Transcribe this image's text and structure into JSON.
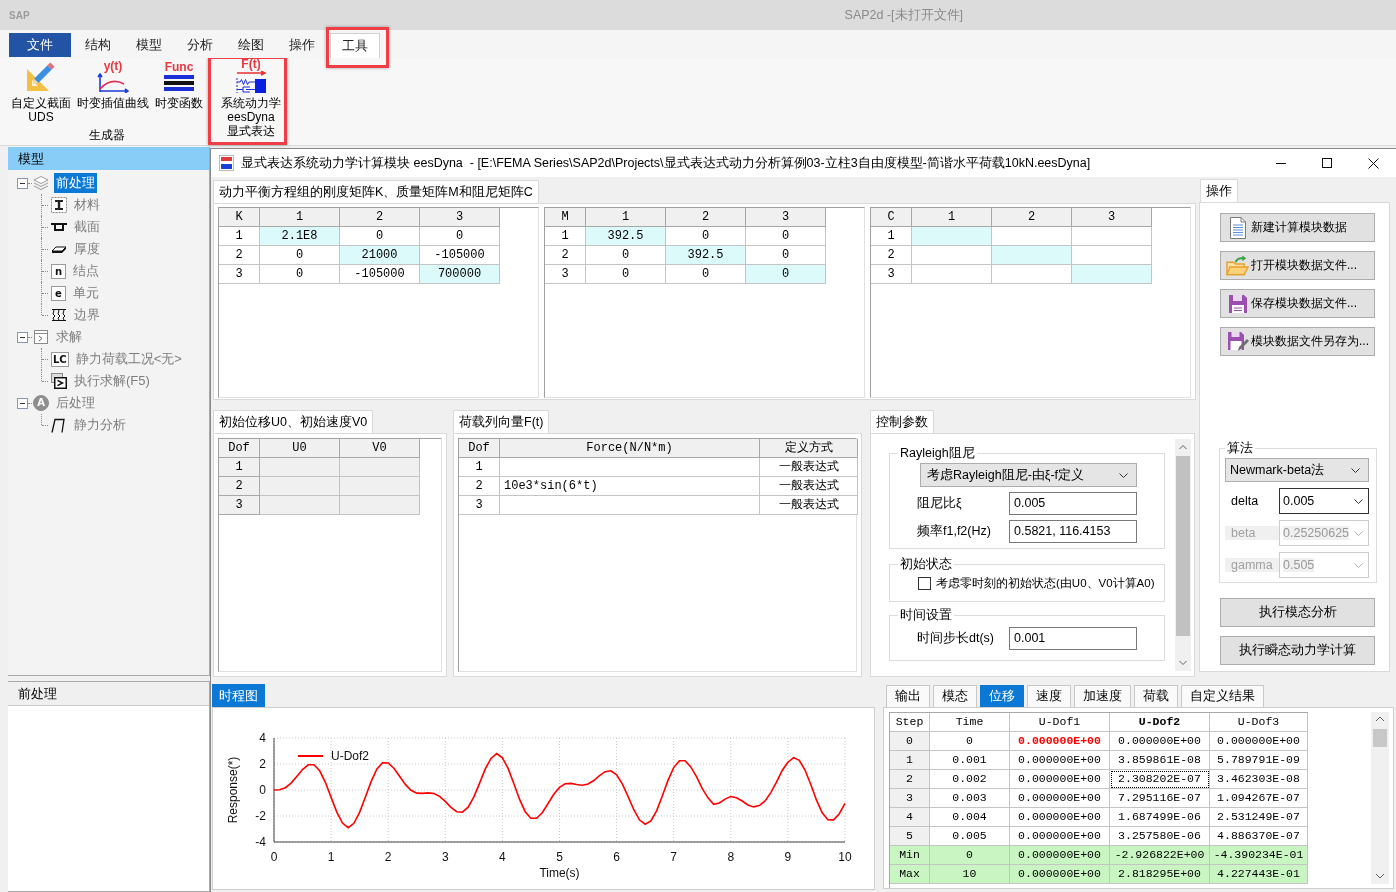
{
  "window": {
    "app_mark": "SAP",
    "title": "SAP2d -[未打开文件]"
  },
  "ribbon": {
    "tabs": [
      {
        "label": "文件",
        "kind": "menu",
        "selected": false,
        "highlighted": false
      },
      {
        "label": "结构",
        "kind": "tab",
        "selected": false,
        "highlighted": false
      },
      {
        "label": "模型",
        "kind": "tab",
        "selected": false,
        "highlighted": false
      },
      {
        "label": "分析",
        "kind": "tab",
        "selected": false,
        "highlighted": false
      },
      {
        "label": "绘图",
        "kind": "tab",
        "selected": false,
        "highlighted": false
      },
      {
        "label": "操作",
        "kind": "tab",
        "selected": false,
        "highlighted": false
      },
      {
        "label": "工具",
        "kind": "tab",
        "selected": true,
        "highlighted": true
      }
    ],
    "groups": [
      {
        "label": "生成器",
        "tools": [
          {
            "kind": "section",
            "label_lines": [
              "自定义截面",
              "UDS"
            ],
            "highlighted": false
          },
          {
            "kind": "curve",
            "icon_text": "y(t)",
            "label_lines": [
              "时变插值曲线"
            ],
            "highlighted": false
          },
          {
            "kind": "function",
            "icon_text": "Func",
            "label_lines": [
              "时变函数"
            ],
            "highlighted": false
          }
        ]
      },
      {
        "tools": [
          {
            "kind": "dynamics",
            "icon_text": "F(t)",
            "label_lines": [
              "系统动力学",
              "eesDyna",
              "显式表达"
            ],
            "highlighted": true
          }
        ]
      }
    ]
  },
  "model_panel": {
    "title": "模型",
    "tree": [
      {
        "label": "前处理",
        "kind": "layers",
        "expanded": true,
        "selected": true,
        "children": [
          {
            "label": "材料",
            "kind": "material",
            "selected": false
          },
          {
            "label": "截面",
            "kind": "section",
            "selected": false
          },
          {
            "label": "厚度",
            "kind": "thickness",
            "selected": false
          },
          {
            "label": "结点",
            "kind": "letter",
            "icon_text": "n",
            "selected": false
          },
          {
            "label": "单元",
            "kind": "letter",
            "icon_text": "e",
            "selected": false
          },
          {
            "label": "边界",
            "kind": "boundary",
            "selected": false
          }
        ]
      },
      {
        "label": "求解",
        "kind": "solve",
        "expanded": true,
        "selected": false,
        "children": [
          {
            "label": "静力荷载工况<无>",
            "kind": "letter",
            "icon_text": "LC",
            "selected": false
          },
          {
            "label": "执行求解(F5)",
            "kind": "run",
            "selected": false
          }
        ]
      },
      {
        "label": "后处理",
        "kind": "badge",
        "icon_text": "A",
        "expanded": true,
        "selected": false,
        "children": [
          {
            "label": "静力分析",
            "kind": "pulse",
            "selected": false
          }
        ]
      }
    ]
  },
  "pre_panel": {
    "title": "前处理"
  },
  "child_window": {
    "title": "显式表达系统动力学计算模块 eesDyna  - [E:\\FEMA Series\\SAP2d\\Projects\\显式表达式动力分析算例03-立柱3自由度模型-简谐水平荷载10kN.eesDyna]"
  },
  "matrix_tab": {
    "label": "动力平衡方程组的刚度矩阵K、质量矩阵M和阻尼矩阵C",
    "selected": true
  },
  "matrices": [
    {
      "name": "K",
      "diagonal_highlighted": true,
      "columns": [
        "1",
        "2",
        "3"
      ],
      "rows": [
        {
          "label": "1",
          "values": [
            "2.1E8",
            "0",
            "0"
          ]
        },
        {
          "label": "2",
          "values": [
            "0",
            "21000",
            "-105000"
          ]
        },
        {
          "label": "3",
          "values": [
            "0",
            "-105000",
            "700000"
          ]
        }
      ]
    },
    {
      "name": "M",
      "diagonal_highlighted": true,
      "columns": [
        "1",
        "2",
        "3"
      ],
      "rows": [
        {
          "label": "1",
          "values": [
            "392.5",
            "0",
            "0"
          ]
        },
        {
          "label": "2",
          "values": [
            "0",
            "392.5",
            "0"
          ]
        },
        {
          "label": "3",
          "values": [
            "0",
            "0",
            "0"
          ]
        }
      ]
    },
    {
      "name": "C",
      "diagonal_highlighted": true,
      "columns": [
        "1",
        "2",
        "3"
      ],
      "rows": [
        {
          "label": "1"
        },
        {
          "label": "2"
        },
        {
          "label": "3"
        }
      ]
    }
  ],
  "initial_panel": {
    "tab": {
      "label": "初始位移U0、初始速度V0",
      "selected": true
    },
    "disabled": true,
    "columns": [
      "Dof",
      "U0",
      "V0"
    ],
    "rows": [
      {
        "dof": "1"
      },
      {
        "dof": "2"
      },
      {
        "dof": "3"
      }
    ]
  },
  "load_panel": {
    "tab": {
      "label": "荷载列向量F(t)",
      "selected": true
    },
    "columns": [
      "Dof",
      "Force(N/N*m)",
      "定义方式"
    ],
    "rows": [
      {
        "dof": "1",
        "method": "一般表达式"
      },
      {
        "dof": "2",
        "force": "10e3*sin(6*t)",
        "method": "一般表达式"
      },
      {
        "dof": "3",
        "method": "一般表达式"
      }
    ]
  },
  "control_panel": {
    "tab": {
      "label": "控制参数",
      "selected": true
    },
    "groups": [
      {
        "title": "Rayleigh阻尼",
        "items": [
          {
            "kind": "select",
            "value": "考虑Rayleigh阻尼-由ξ-f定义"
          },
          {
            "kind": "input",
            "label": "阻尼比ξ",
            "value": "0.005"
          },
          {
            "kind": "input",
            "label": "频率f1,f2(Hz)",
            "value": "0.5821, 116.4153"
          }
        ]
      },
      {
        "title": "初始状态",
        "items": [
          {
            "kind": "checkbox",
            "label": "考虑零时刻的初始状态(由U0、V0计算A0)",
            "checked": false
          }
        ]
      },
      {
        "title": "时间设置",
        "items": [
          {
            "kind": "input",
            "label": "时间步长dt(s)",
            "value": "0.001"
          }
        ]
      }
    ]
  },
  "ops_panel": {
    "tab": {
      "label": "操作",
      "selected": true
    },
    "buttons": [
      {
        "kind": "new",
        "label": "新建计算模块数据"
      },
      {
        "kind": "open",
        "label": "打开模块数据文件..."
      },
      {
        "kind": "save",
        "label": "保存模块数据文件..."
      },
      {
        "kind": "save_as",
        "label": "模块数据文件另存为..."
      }
    ],
    "algorithm": {
      "title": "算法",
      "method": "Newmark-beta法",
      "params": [
        {
          "label": "delta",
          "value": "0.005",
          "disabled": false
        },
        {
          "label": "beta",
          "value": "0.25250625",
          "disabled": true
        },
        {
          "label": "gamma",
          "value": "0.505",
          "disabled": true
        }
      ]
    },
    "actions": [
      "执行模态分析",
      "执行瞬态动力学计算"
    ]
  },
  "chart_panel": {
    "tab": {
      "label": "时程图",
      "selected": true
    },
    "chart_data": {
      "type": "line",
      "xlabel": "Time(s)",
      "ylabel": "Response(*)",
      "x": [
        0,
        0.1,
        0.2,
        0.3,
        0.4,
        0.5,
        0.6,
        0.7,
        0.8,
        0.9,
        1,
        1.1,
        1.2,
        1.3,
        1.4,
        1.5,
        1.6,
        1.7,
        1.8,
        1.9,
        2,
        2.1,
        2.2,
        2.3,
        2.4,
        2.5,
        2.6,
        2.7,
        2.8,
        2.9,
        3,
        3.1,
        3.2,
        3.3,
        3.4,
        3.5,
        3.6,
        3.7,
        3.8,
        3.9,
        4,
        4.1,
        4.2,
        4.3,
        4.4,
        4.5,
        4.6,
        4.7,
        4.8,
        4.9,
        5,
        5.1,
        5.2,
        5.3,
        5.4,
        5.5,
        5.6,
        5.7,
        5.8,
        5.9,
        6,
        6.1,
        6.2,
        6.3,
        6.4,
        6.5,
        6.6,
        6.7,
        6.8,
        6.9,
        7,
        7.1,
        7.2,
        7.3,
        7.4,
        7.5,
        7.6,
        7.7,
        7.8,
        7.9,
        8,
        8.1,
        8.2,
        8.3,
        8.4,
        8.5,
        8.6,
        8.7,
        8.8,
        8.9,
        9,
        9.1,
        9.2,
        9.3,
        9.4,
        9.5,
        9.6,
        9.7,
        9.8,
        9.9,
        10
      ],
      "series": [
        {
          "name": "U-Dof2",
          "color": "#ff0000",
          "values": [
            0,
            0.02,
            0.18,
            0.53,
            1.04,
            1.57,
            1.94,
            1.94,
            1.48,
            0.59,
            -0.57,
            -1.7,
            -2.55,
            -2.9,
            -2.56,
            -1.72,
            -0.54,
            0.65,
            1.6,
            2.09,
            2.08,
            1.68,
            1.05,
            0.43,
            -0.02,
            -0.24,
            -0.26,
            -0.22,
            -0.27,
            -0.49,
            -0.88,
            -1.34,
            -1.67,
            -1.71,
            -1.32,
            -0.53,
            0.53,
            1.62,
            2.43,
            2.8,
            2.48,
            1.66,
            0.5,
            -0.71,
            -1.67,
            -2.18,
            -2.18,
            -1.73,
            -1.04,
            -0.33,
            0.2,
            0.48,
            0.51,
            0.42,
            0.36,
            0.46,
            0.73,
            1.1,
            1.41,
            1.48,
            1.17,
            0.48,
            -0.49,
            -1.5,
            -2.29,
            -2.63,
            -2.38,
            -1.6,
            -0.46,
            0.74,
            1.72,
            2.25,
            2.25,
            1.78,
            1.03,
            0.1,
            -0.6,
            -1.1,
            -1.0,
            -0.7,
            -0.5,
            -0.6,
            -0.85,
            -1.15,
            -1.3,
            -1.2,
            -0.85,
            -0.2,
            0.6,
            1.5,
            2.14,
            2.49,
            2.28,
            1.54,
            0.44,
            -0.76,
            -1.75,
            -2.29,
            -2.3,
            -1.82,
            -1.02
          ]
        }
      ],
      "xlim": [
        0,
        10
      ],
      "ylim": [
        -4,
        4
      ],
      "xticks": [
        0,
        1,
        2,
        3,
        4,
        5,
        6,
        7,
        8,
        9,
        10
      ],
      "yticks": [
        -4,
        -2,
        0,
        2,
        4
      ],
      "grid": true
    }
  },
  "results": {
    "tabs": [
      {
        "label": "输出",
        "selected": false
      },
      {
        "label": "模态",
        "selected": false
      },
      {
        "label": "位移",
        "selected": true
      },
      {
        "label": "速度",
        "selected": false
      },
      {
        "label": "加速度",
        "selected": false
      },
      {
        "label": "荷载",
        "selected": false
      },
      {
        "label": "自定义结果",
        "selected": false
      }
    ],
    "columns": [
      {
        "label": "Step",
        "selected": false
      },
      {
        "label": "Time",
        "selected": false
      },
      {
        "label": "U-Dof1",
        "selected": false
      },
      {
        "label": "U-Dof2",
        "selected": true
      },
      {
        "label": "U-Dof3",
        "selected": false
      }
    ],
    "rows": [
      {
        "kind": "data",
        "cells": [
          {
            "text": "0",
            "selected": false,
            "flagged": false
          },
          {
            "text": "0",
            "selected": false,
            "flagged": false
          },
          {
            "text": "0.000000E+00",
            "selected": false,
            "flagged": true
          },
          {
            "text": "0.000000E+00",
            "selected": false,
            "flagged": false
          },
          {
            "text": "0.000000E+00",
            "selected": false,
            "flagged": false
          }
        ]
      },
      {
        "kind": "data",
        "cells": [
          {
            "text": "1",
            "selected": false,
            "flagged": false
          },
          {
            "text": "0.001",
            "selected": false,
            "flagged": false
          },
          {
            "text": "0.000000E+00",
            "selected": false,
            "flagged": false
          },
          {
            "text": "3.859861E-08",
            "selected": false,
            "flagged": false
          },
          {
            "text": "5.789791E-09",
            "selected": false,
            "flagged": false
          }
        ]
      },
      {
        "kind": "data",
        "cells": [
          {
            "text": "2",
            "selected": false,
            "flagged": false
          },
          {
            "text": "0.002",
            "selected": false,
            "flagged": false
          },
          {
            "text": "0.000000E+00",
            "selected": false,
            "flagged": false
          },
          {
            "text": "2.308202E-07",
            "selected": true,
            "flagged": false
          },
          {
            "text": "3.462303E-08",
            "selected": false,
            "flagged": false
          }
        ]
      },
      {
        "kind": "data",
        "cells": [
          {
            "text": "3",
            "selected": false,
            "flagged": false
          },
          {
            "text": "0.003",
            "selected": false,
            "flagged": false
          },
          {
            "text": "0.000000E+00",
            "selected": false,
            "flagged": false
          },
          {
            "text": "7.295116E-07",
            "selected": false,
            "flagged": false
          },
          {
            "text": "1.094267E-07",
            "selected": false,
            "flagged": false
          }
        ]
      },
      {
        "kind": "data",
        "cells": [
          {
            "text": "4",
            "selected": false,
            "flagged": false
          },
          {
            "text": "0.004",
            "selected": false,
            "flagged": false
          },
          {
            "text": "0.000000E+00",
            "selected": false,
            "flagged": false
          },
          {
            "text": "1.687499E-06",
            "selected": false,
            "flagged": false
          },
          {
            "text": "2.531249E-07",
            "selected": false,
            "flagged": false
          }
        ]
      },
      {
        "kind": "data",
        "cells": [
          {
            "text": "5",
            "selected": false,
            "flagged": false
          },
          {
            "text": "0.005",
            "selected": false,
            "flagged": false
          },
          {
            "text": "0.000000E+00",
            "selected": false,
            "flagged": false
          },
          {
            "text": "3.257580E-06",
            "selected": false,
            "flagged": false
          },
          {
            "text": "4.886370E-07",
            "selected": false,
            "flagged": false
          }
        ]
      },
      {
        "kind": "summary",
        "cells": [
          {
            "text": "Min",
            "selected": false,
            "flagged": false
          },
          {
            "text": "0",
            "selected": false,
            "flagged": false
          },
          {
            "text": "0.000000E+00",
            "selected": false,
            "flagged": false
          },
          {
            "text": "-2.926822E+00",
            "selected": false,
            "flagged": false
          },
          {
            "text": "-4.390234E-01",
            "selected": false,
            "flagged": false
          }
        ]
      },
      {
        "kind": "summary",
        "cells": [
          {
            "text": "Max",
            "selected": false,
            "flagged": false
          },
          {
            "text": "10",
            "selected": false,
            "flagged": false
          },
          {
            "text": "0.000000E+00",
            "selected": false,
            "flagged": false
          },
          {
            "text": "2.818295E+00",
            "selected": false,
            "flagged": false
          },
          {
            "text": "4.227443E-01",
            "selected": false,
            "flagged": false
          }
        ]
      }
    ]
  }
}
